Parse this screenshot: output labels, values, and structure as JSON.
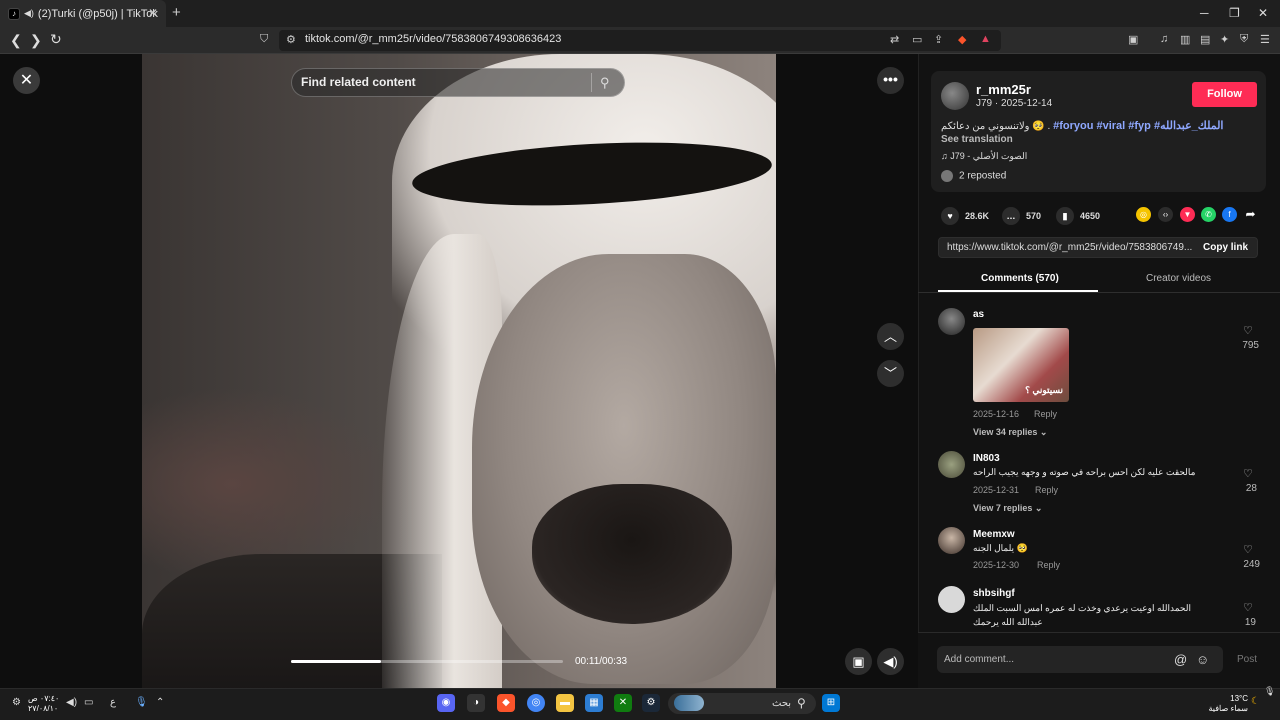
{
  "browser": {
    "tab_title": "(2)Turki (@p50j) | TikTok",
    "url": "tiktok.com/@r_mm25r/video/7583806749308636423"
  },
  "video": {
    "search_placeholder": "Find related content",
    "time": "00:11/00:33",
    "progress_fraction": 0.33
  },
  "post": {
    "username": "r_mm25r",
    "subline": "J79 · 2025-12-14",
    "follow_label": "Follow",
    "caption_text": "ولاتنسوني من دعائكم 🥺 .",
    "caption_tags": "#foryou #viral #fyp #الملك_عبدالله",
    "see_translation": "See translation",
    "sound": "♫ J79 - الصوت الأصلي",
    "reposted": "2 reposted"
  },
  "stats": {
    "likes": "28.6K",
    "comments": "570",
    "saves": "4650"
  },
  "link": {
    "url": "https://www.tiktok.com/@r_mm25r/video/7583806749...",
    "copy_label": "Copy link"
  },
  "tabs": {
    "comments": "Comments (570)",
    "creator": "Creator videos"
  },
  "comments": [
    {
      "name": "as",
      "text": "",
      "image_caption": "نسيتوني ؟",
      "date": "2025-12-16",
      "reply": "Reply",
      "likes": "795",
      "view_replies": "View 34 replies ⌄"
    },
    {
      "name": "IN803",
      "text": "مالحقت عليه لكن احس براحه في صوته و وجهه يجيب الراحه",
      "date": "2025-12-31",
      "reply": "Reply",
      "likes": "28",
      "view_replies": "View 7 replies ⌄"
    },
    {
      "name": "Meemxw",
      "text": "يلمال الجنه 🥺",
      "date": "2025-12-30",
      "reply": "Reply",
      "likes": "249"
    },
    {
      "name": "shbsihgf",
      "text": "الحمدالله اوعيت يرعدي وخذت له عمره امس السبت الملك عبدالله الله يرحمك",
      "likes": "19"
    }
  ],
  "composer": {
    "placeholder": "Add comment...",
    "post_label": "Post"
  },
  "taskbar": {
    "search_text": "بحث",
    "clock_time": "٠٧:٤٠ ص",
    "clock_date": "٢٧/٠٨/١٠",
    "temperature": "13°C",
    "weather": "سماء صافية"
  },
  "icons": {
    "close": "close-icon",
    "search": "search-icon",
    "more": "more-icon",
    "like": "heart-icon",
    "comment": "comment-icon",
    "save": "bookmark-icon"
  }
}
